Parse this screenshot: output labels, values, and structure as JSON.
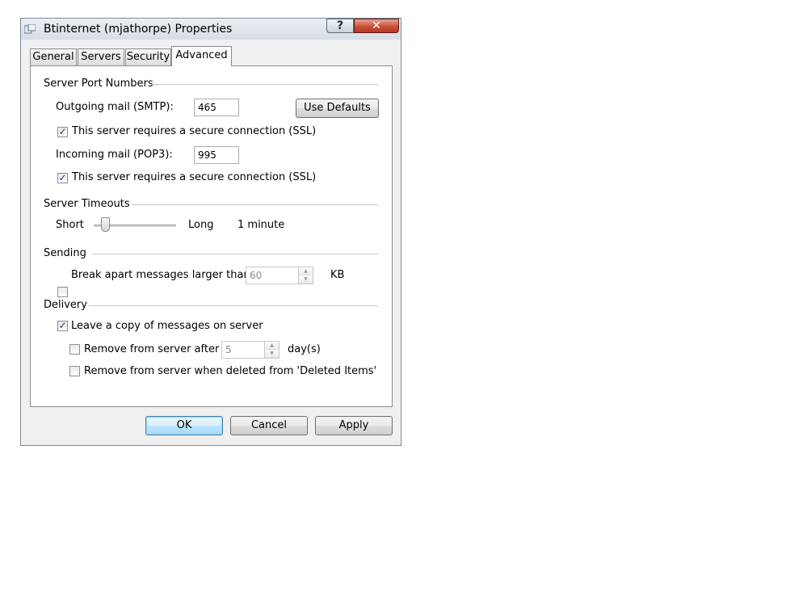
{
  "window": {
    "title": "Btinternet (mjathorpe) Properties",
    "help_label": "?",
    "close_label": "✕"
  },
  "tabs": [
    {
      "label": "General"
    },
    {
      "label": "Servers"
    },
    {
      "label": "Security"
    },
    {
      "label": "Advanced"
    }
  ],
  "server_port_numbers": {
    "heading": "Server Port Numbers",
    "outgoing_label": "Outgoing mail (SMTP):",
    "outgoing_value": "465",
    "outgoing_ssl_label": "This server requires a secure connection (SSL)",
    "outgoing_ssl_checked": true,
    "incoming_label": "Incoming mail (POP3):",
    "incoming_value": "995",
    "incoming_ssl_label": "This server requires a secure connection (SSL)",
    "incoming_ssl_checked": true,
    "use_defaults_label": "Use Defaults"
  },
  "server_timeouts": {
    "heading": "Server Timeouts",
    "short_label": "Short",
    "long_label": "Long",
    "value_text": "1 minute",
    "slider_fraction": 0.1
  },
  "sending": {
    "heading": "Sending",
    "break_apart_label": "Break apart messages larger than",
    "break_apart_checked": false,
    "size_value": "60",
    "unit_label": "KB"
  },
  "delivery": {
    "heading": "Delivery",
    "leave_copy_label": "Leave a copy of messages on server",
    "leave_copy_checked": true,
    "remove_after_label": "Remove from server after",
    "remove_after_checked": false,
    "days_value": "5",
    "days_unit": "day(s)",
    "remove_deleted_label": "Remove from server when deleted from 'Deleted Items'",
    "remove_deleted_checked": false
  },
  "footer": {
    "ok_label": "OK",
    "cancel_label": "Cancel",
    "apply_label": "Apply"
  },
  "check_glyph": "✓"
}
